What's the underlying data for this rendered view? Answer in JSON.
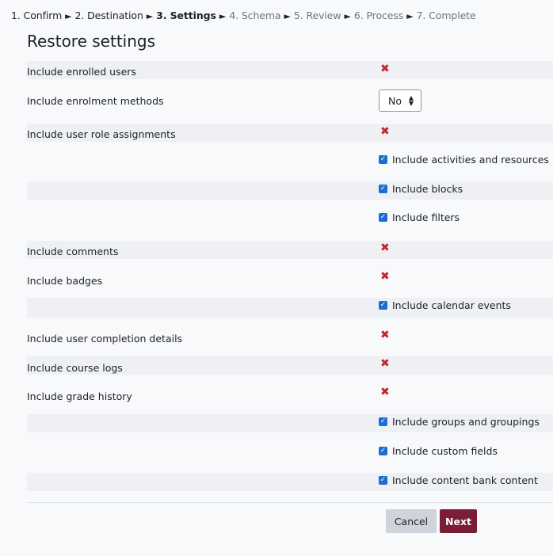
{
  "breadcrumb": {
    "steps": [
      "1. Confirm",
      "2. Destination",
      "3. Settings",
      "4. Schema",
      "5. Review",
      "6. Process",
      "7. Complete"
    ],
    "separator": "►"
  },
  "page_title": "Restore settings",
  "settings": {
    "enrolled_users": {
      "label": "Include enrolled users",
      "value": "✖"
    },
    "enrolment_methods": {
      "label": "Include enrolment methods",
      "selected": "No"
    },
    "role_assignments": {
      "label": "Include user role assignments",
      "value": "✖"
    },
    "activities": {
      "label": "Include activities and resources",
      "checked": true
    },
    "blocks": {
      "label": "Include blocks",
      "checked": true
    },
    "filters": {
      "label": "Include filters",
      "checked": true
    },
    "comments": {
      "label": "Include comments",
      "value": "✖"
    },
    "badges": {
      "label": "Include badges",
      "value": "✖"
    },
    "calendar": {
      "label": "Include calendar events",
      "checked": true
    },
    "completion": {
      "label": "Include user completion details",
      "value": "✖"
    },
    "logs": {
      "label": "Include course logs",
      "value": "✖"
    },
    "grade_history": {
      "label": "Include grade history",
      "value": "✖"
    },
    "groups": {
      "label": "Include groups and groupings",
      "checked": true
    },
    "custom_fields": {
      "label": "Include custom fields",
      "checked": true
    },
    "content_bank": {
      "label": "Include content bank content",
      "checked": true
    }
  },
  "checkmark": "✓",
  "buttons": {
    "cancel": "Cancel",
    "next": "Next"
  },
  "colors": {
    "accent": "#7b1d34",
    "checkbox": "#1a6dd4",
    "cross": "#c0272d",
    "shaded_row": "#eef0f3"
  }
}
